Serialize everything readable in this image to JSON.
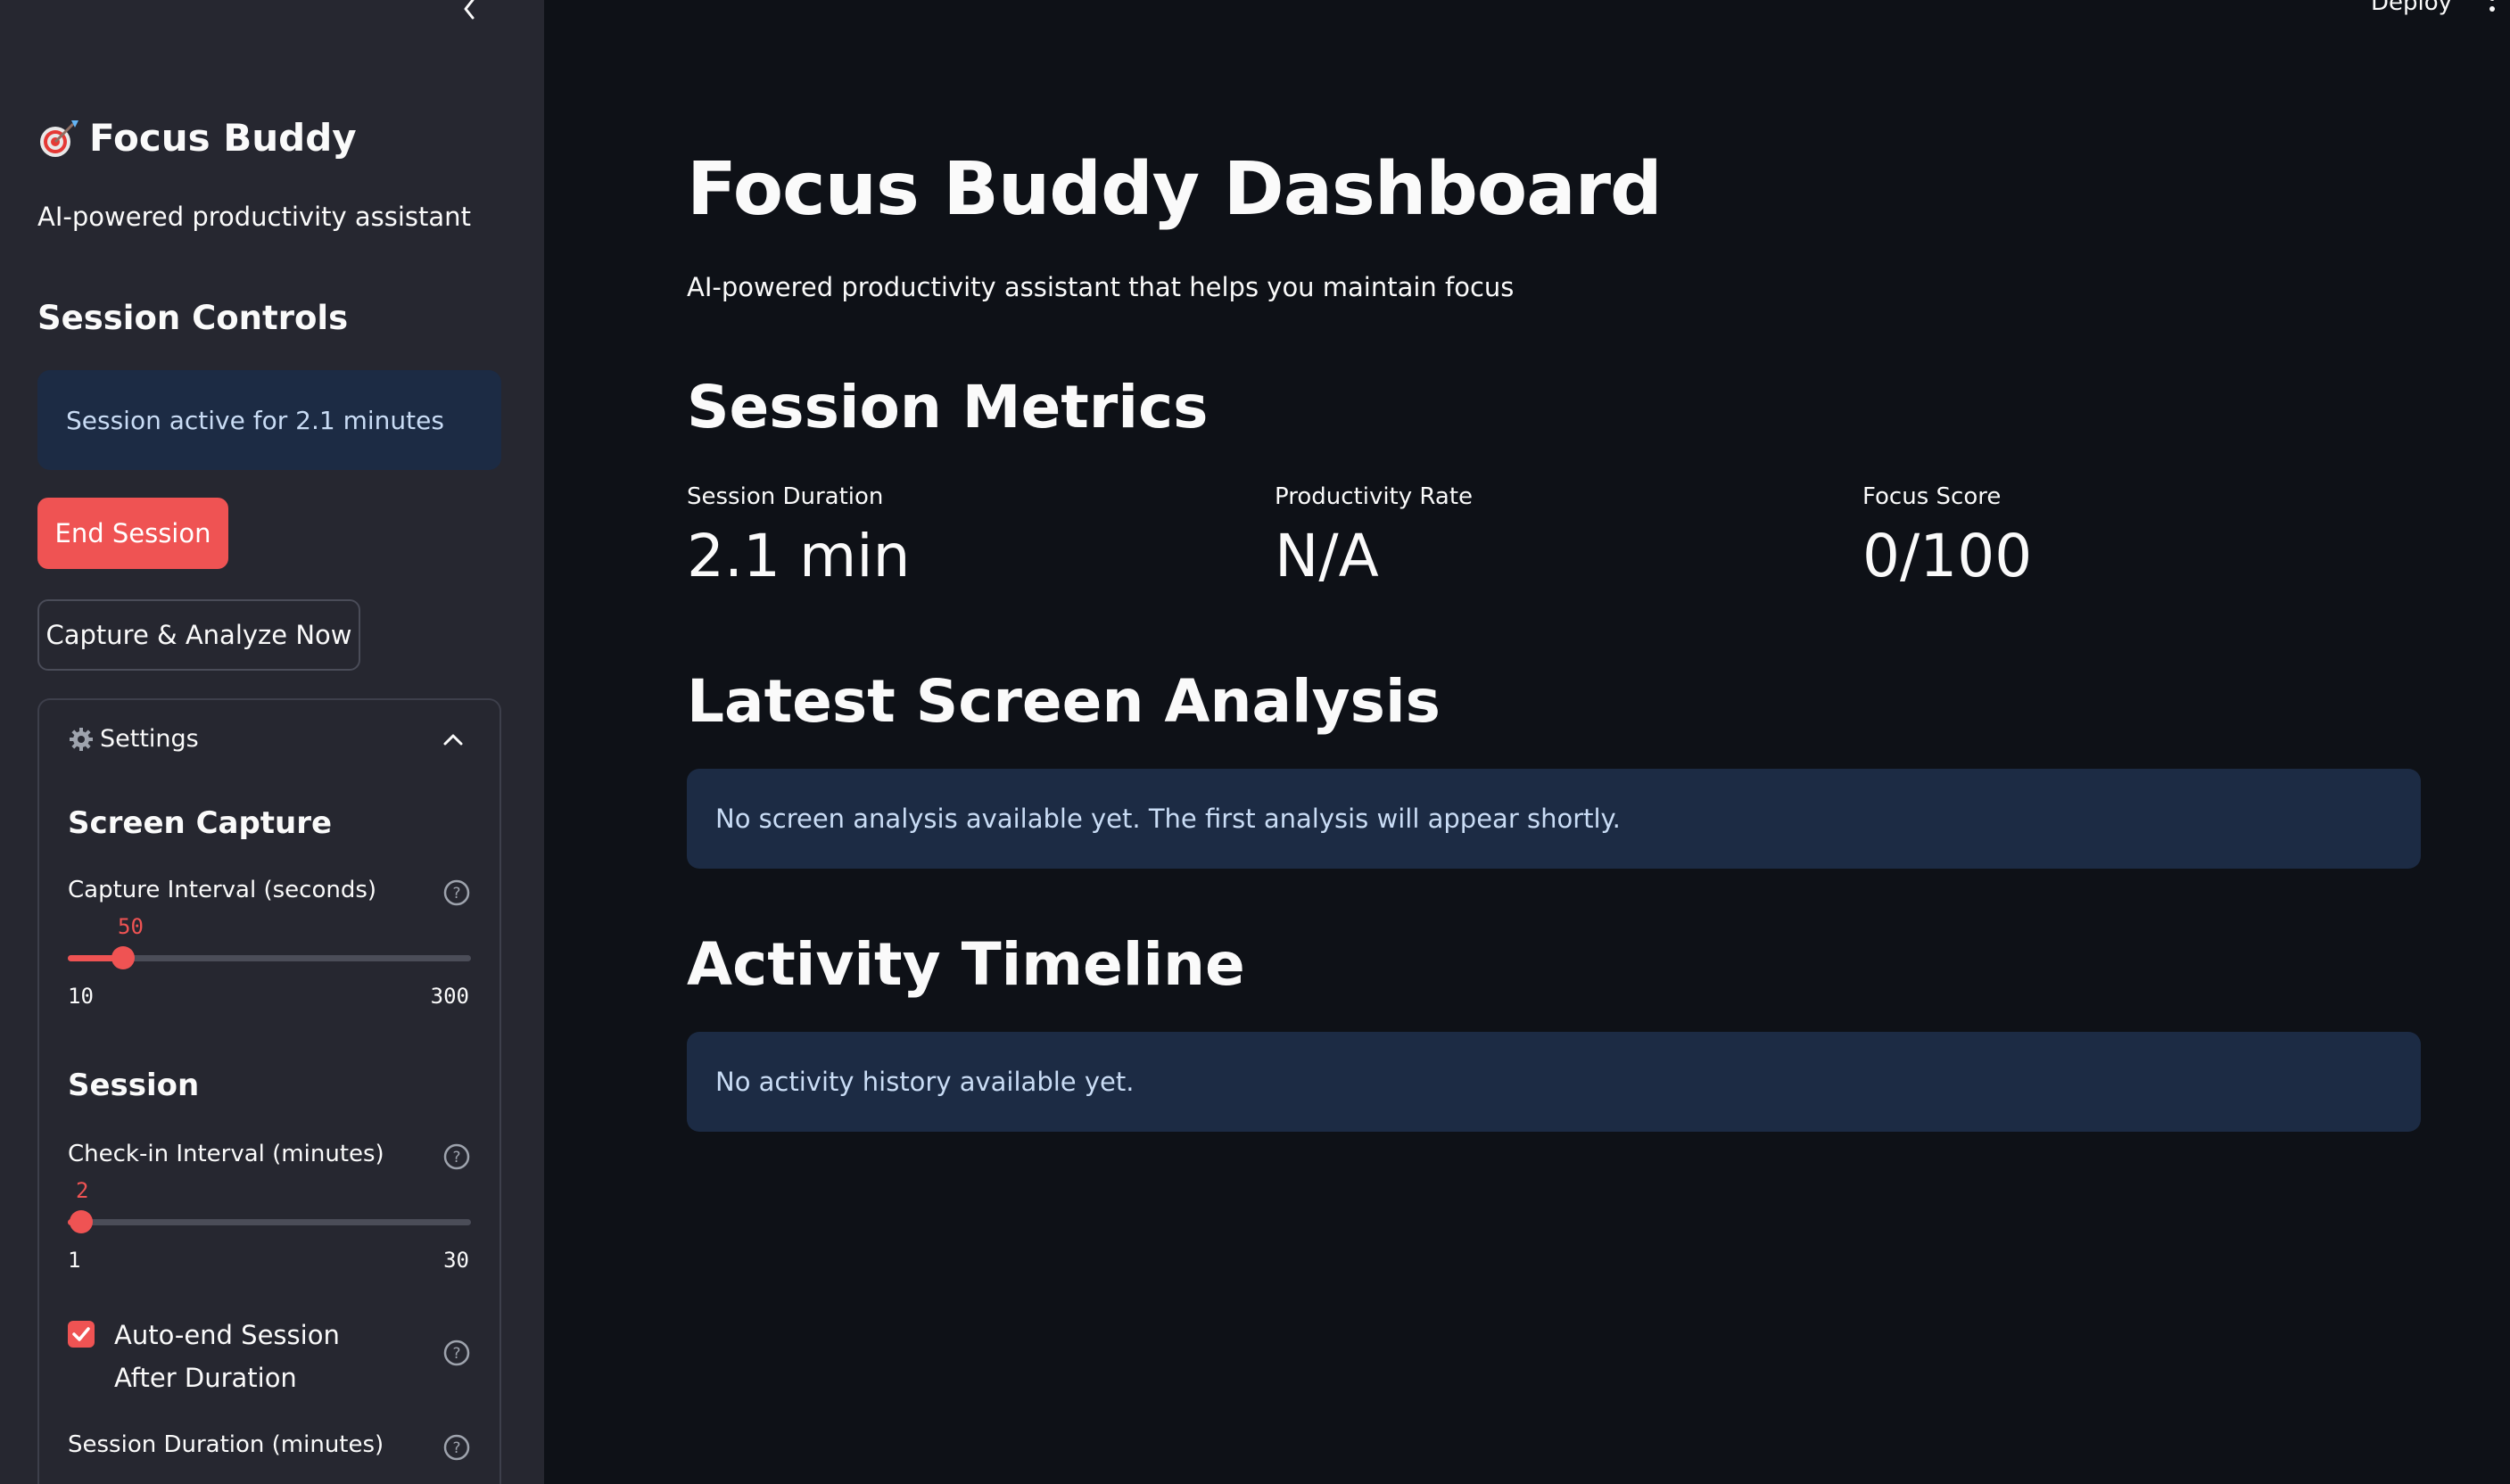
{
  "sidebar": {
    "brand_title": "Focus Buddy",
    "brand_subtitle": "AI-powered productivity assistant",
    "session_controls_heading": "Session Controls",
    "session_status": "Session active for 2.1 minutes",
    "end_session_label": "End Session",
    "capture_label": "Capture & Analyze Now",
    "settings": {
      "title": "Settings",
      "screen_capture_heading": "Screen Capture",
      "capture_interval": {
        "label": "Capture Interval (seconds)",
        "value": "50",
        "min": "10",
        "max": "300",
        "fraction": 0.138
      },
      "session_heading": "Session",
      "checkin_interval": {
        "label": "Check-in Interval (minutes)",
        "value": "2",
        "min": "1",
        "max": "30",
        "fraction": 0.034
      },
      "auto_end": {
        "label": "Auto-end Session After Duration",
        "checked": true
      },
      "session_duration_label": "Session Duration (minutes)"
    }
  },
  "header": {
    "deploy_label": "Deploy"
  },
  "main": {
    "title": "Focus Buddy Dashboard",
    "subtitle": "AI-powered productivity assistant that helps you maintain focus",
    "metrics_heading": "Session Metrics",
    "metrics": [
      {
        "label": "Session Duration",
        "value": "2.1 min"
      },
      {
        "label": "Productivity Rate",
        "value": "N/A"
      },
      {
        "label": "Focus Score",
        "value": "0/100"
      }
    ],
    "analysis_heading": "Latest Screen Analysis",
    "analysis_message": "No screen analysis available yet. The first analysis will appear shortly.",
    "timeline_heading": "Activity Timeline",
    "timeline_message": "No activity history available yet."
  },
  "colors": {
    "accent": "#ef5353",
    "sidebar_bg": "#262730",
    "main_bg": "#0e1117",
    "info_bg": "#1c2b44"
  }
}
